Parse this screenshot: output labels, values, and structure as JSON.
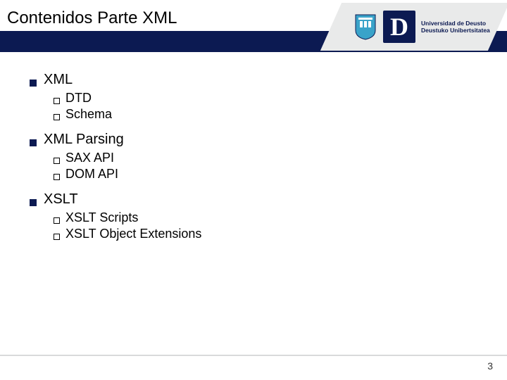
{
  "slide": {
    "title": "Contenidos Parte XML",
    "page_number": "3"
  },
  "logo": {
    "letter": "D",
    "line1": "Universidad de Deusto",
    "line2": "Deustuko Unibertsitatea"
  },
  "outline": [
    {
      "label": "XML",
      "children": [
        {
          "label": "DTD"
        },
        {
          "label": "Schema"
        }
      ]
    },
    {
      "label": "XML Parsing",
      "children": [
        {
          "label": "SAX API"
        },
        {
          "label": "DOM API"
        }
      ]
    },
    {
      "label": "XSLT",
      "children": [
        {
          "label": "XSLT Scripts"
        },
        {
          "label": "XSLT Object Extensions"
        }
      ]
    }
  ]
}
